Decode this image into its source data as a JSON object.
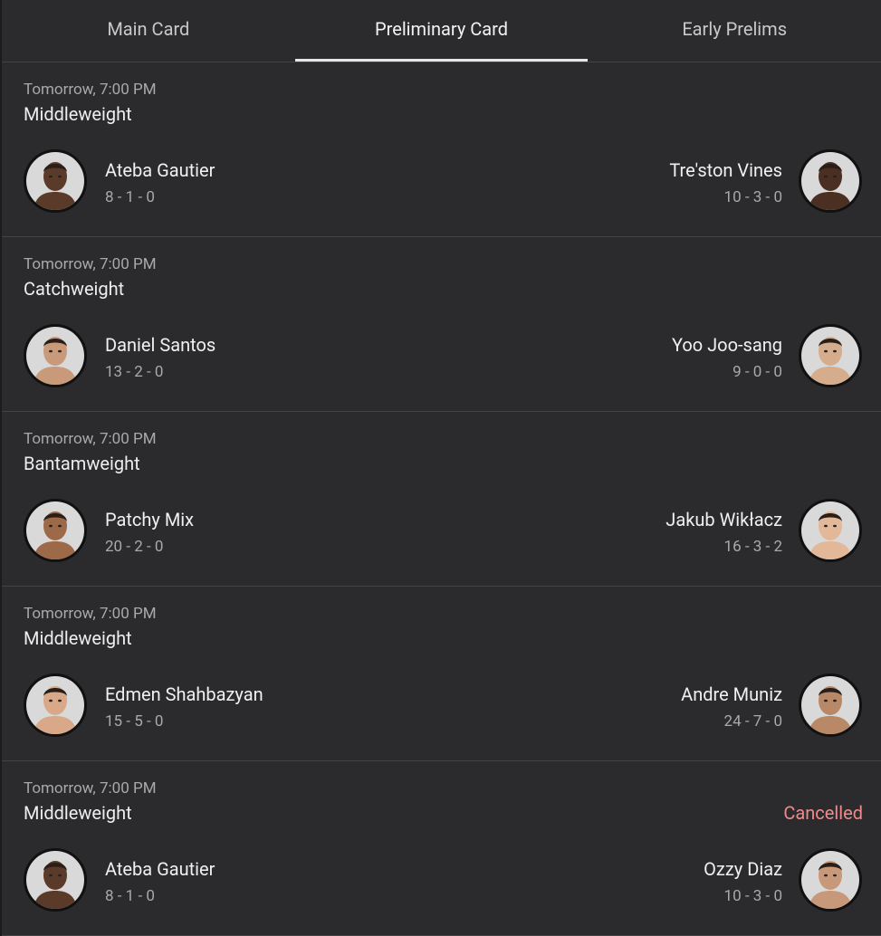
{
  "tabs": [
    {
      "label": "Main Card"
    },
    {
      "label": "Preliminary Card"
    },
    {
      "label": "Early Prelims"
    }
  ],
  "fights": [
    {
      "time": "Tomorrow, 7:00 PM",
      "weight_class": "Middleweight",
      "status": "",
      "left": {
        "name": "Ateba Gautier",
        "record": "8 - 1 - 0",
        "skin": "#5a3a28"
      },
      "right": {
        "name": "Tre'ston Vines",
        "record": "10 - 3 - 0",
        "skin": "#4a2f22"
      }
    },
    {
      "time": "Tomorrow, 7:00 PM",
      "weight_class": "Catchweight",
      "status": "",
      "left": {
        "name": "Daniel Santos",
        "record": "13 - 2 - 0",
        "skin": "#c99a7a"
      },
      "right": {
        "name": "Yoo Joo-sang",
        "record": "9 - 0 - 0",
        "skin": "#d6ad8c"
      }
    },
    {
      "time": "Tomorrow, 7:00 PM",
      "weight_class": "Bantamweight",
      "status": "",
      "left": {
        "name": "Patchy Mix",
        "record": "20 - 2 - 0",
        "skin": "#9c6a48"
      },
      "right": {
        "name": "Jakub Wikłacz",
        "record": "16 - 3 - 2",
        "skin": "#e2b898"
      }
    },
    {
      "time": "Tomorrow, 7:00 PM",
      "weight_class": "Middleweight",
      "status": "",
      "left": {
        "name": "Edmen Shahbazyan",
        "record": "15 - 5 - 0",
        "skin": "#d8a888"
      },
      "right": {
        "name": "Andre Muniz",
        "record": "24 - 7 - 0",
        "skin": "#b98866"
      }
    },
    {
      "time": "Tomorrow, 7:00 PM",
      "weight_class": "Middleweight",
      "status": "Cancelled",
      "left": {
        "name": "Ateba Gautier",
        "record": "8 - 1 - 0",
        "skin": "#5a3a28"
      },
      "right": {
        "name": "Ozzy Diaz",
        "record": "10 - 3 - 0",
        "skin": "#c7997a"
      }
    }
  ],
  "colors": {
    "background": "#2b2b2d",
    "divider": "#444446",
    "cancelled": "#f08a8a"
  }
}
